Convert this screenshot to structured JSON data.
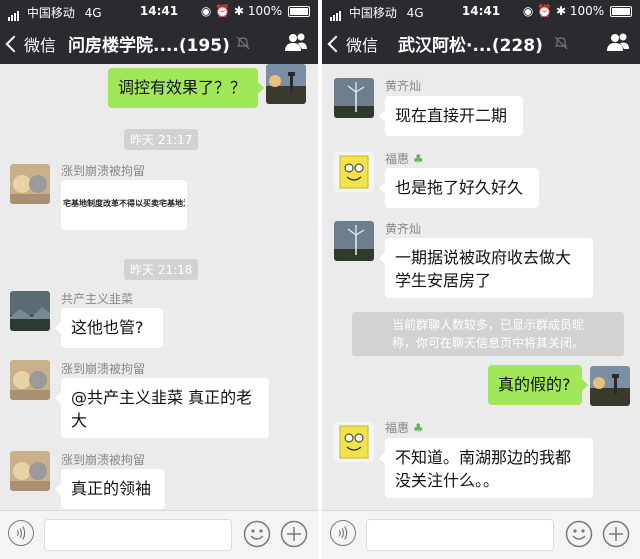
{
  "status": {
    "carrier": "中国移动",
    "network": "4G",
    "time": "14:41",
    "battery": "100%"
  },
  "left": {
    "back_label": "微信",
    "title": "问房楼学院....(195)",
    "messages": {
      "m1": {
        "text": "调控有效果了？？"
      },
      "ts1": "昨天 21:17",
      "m2": {
        "sender": "涨到崩溃被拘留",
        "image_text": "宅基地制度改革不得以买卖宅基地为"
      },
      "ts2": "昨天 21:18",
      "m3": {
        "sender": "共产主义韭菜",
        "text": "这他也管?"
      },
      "m4": {
        "sender": "涨到崩溃被拘留",
        "text_line1": "@共产主义韭菜 真正的老",
        "text_line2": "大"
      },
      "m5": {
        "sender": "涨到崩溃被拘留",
        "text": "真正的领袖"
      }
    }
  },
  "right": {
    "back_label": "微信",
    "title": "武汉阿松·...(228)",
    "messages": {
      "m1": {
        "sender": "黄齐灿",
        "text": "现在直接开二期"
      },
      "m2": {
        "sender": "福惠",
        "text": "也是拖了好久好久"
      },
      "m3": {
        "sender": "黄齐灿",
        "text_line1": "一期据说被政府收去做大",
        "text_line2": "学生安居房了"
      },
      "sys": {
        "line1": "当前群聊人数较多，已显示群成员昵",
        "line2": "称，你可在聊天信息页中将其关闭。"
      },
      "m4": {
        "text": "真的假的?"
      },
      "m5": {
        "sender": "福惠",
        "text_line1": "不知道。南湖那边的我都",
        "text_line2": "没关注什么。。"
      }
    }
  },
  "icons": {
    "sender_badge": "clover-icon",
    "mute": "mute-icon",
    "group": "group-info-icon",
    "voice": "voice-icon",
    "emoji": "emoji-icon",
    "more": "plus-icon"
  },
  "colors": {
    "navbar": "#2b2b2f",
    "chat_bg": "#ebebeb",
    "my_bubble": "#a0e75a",
    "timestamp_bg": "#d2d2d2",
    "badge": "#5cb85c"
  }
}
